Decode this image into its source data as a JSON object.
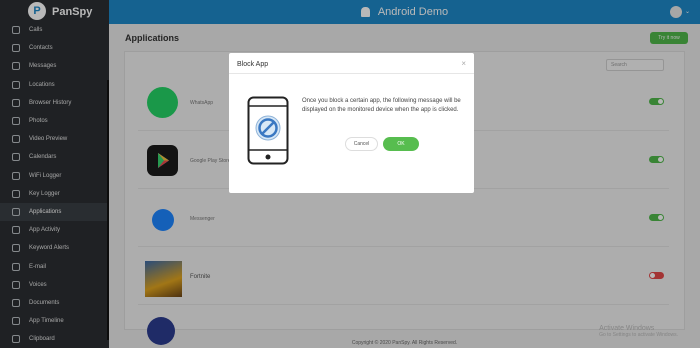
{
  "brand": {
    "name": "PanSpy",
    "logo_letter": "P"
  },
  "topbar": {
    "title": "Android Demo",
    "caret": "⌄"
  },
  "sidebar": {
    "items": [
      {
        "label": "Calls",
        "icon": "phone-icon"
      },
      {
        "label": "Contacts",
        "icon": "contacts-icon"
      },
      {
        "label": "Messages",
        "icon": "message-icon"
      },
      {
        "label": "Locations",
        "icon": "location-icon"
      },
      {
        "label": "Browser History",
        "icon": "browser-icon"
      },
      {
        "label": "Photos",
        "icon": "photo-icon"
      },
      {
        "label": "Video Preview",
        "icon": "video-icon"
      },
      {
        "label": "Calendars",
        "icon": "calendar-icon"
      },
      {
        "label": "WiFi Logger",
        "icon": "wifi-icon"
      },
      {
        "label": "Key Logger",
        "icon": "keyboard-icon"
      },
      {
        "label": "Applications",
        "icon": "applications-icon",
        "active": true
      },
      {
        "label": "App Activity",
        "icon": "activity-icon"
      },
      {
        "label": "Keyword Alerts",
        "icon": "bell-icon"
      },
      {
        "label": "E-mail",
        "icon": "email-icon"
      },
      {
        "label": "Voices",
        "icon": "voice-icon"
      },
      {
        "label": "Documents",
        "icon": "document-icon"
      },
      {
        "label": "App Timeline",
        "icon": "timeline-icon"
      },
      {
        "label": "Clipboard",
        "icon": "clipboard-icon"
      }
    ]
  },
  "main": {
    "title": "Applications",
    "try_button": "Try it now",
    "search_placeholder": "Search",
    "apps": [
      {
        "name": "WhatsApp",
        "enabled": true,
        "icon": "whatsapp-icon"
      },
      {
        "name": "Google Play Store",
        "enabled": true,
        "icon": "play-store-icon"
      },
      {
        "name": "Messenger",
        "enabled": true,
        "icon": "messenger-icon"
      },
      {
        "name": "Fortnite",
        "enabled": false,
        "icon": "fortnite-icon"
      }
    ],
    "footer": "Copyright © 2020 PanSpy. All Rights Reserved.",
    "watermark_title": "Activate Windows",
    "watermark_sub": "Go to Settings to activate Windows."
  },
  "modal": {
    "title": "Block App",
    "close": "×",
    "message": "Once you block a certain app, the following message will be displayed on the monitored device when the app is clicked.",
    "cancel": "Cancel",
    "ok": "OK"
  },
  "colors": {
    "accent": "#1e88c8",
    "success": "#4fb84a",
    "danger": "#e24848",
    "sidebar_bg": "#2b2f33"
  }
}
